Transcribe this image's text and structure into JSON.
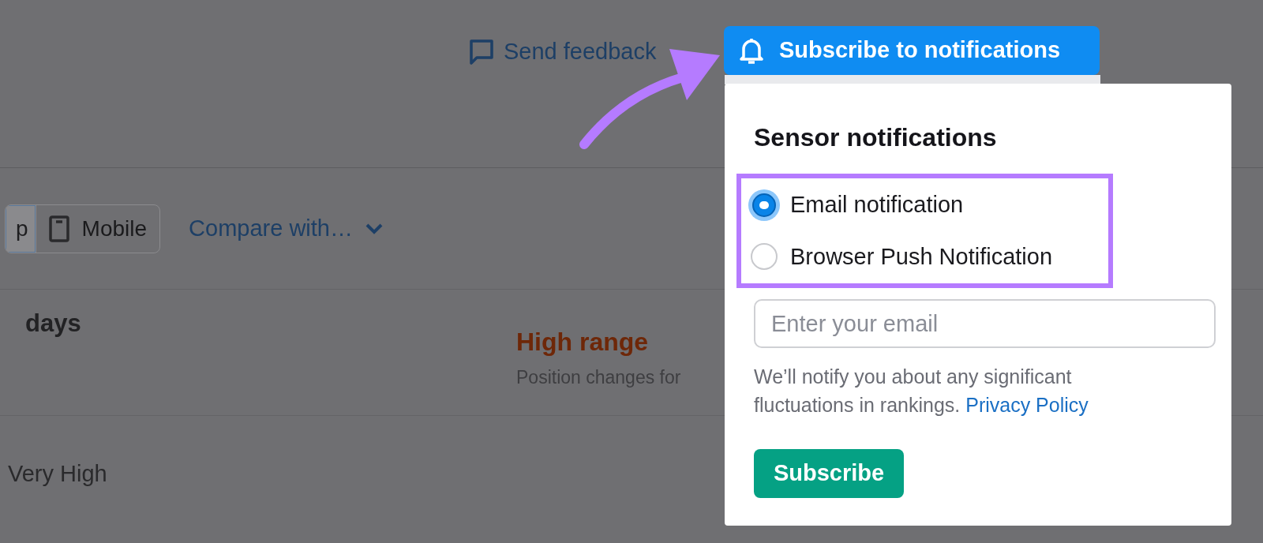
{
  "header": {
    "feedback_link": "Send feedback",
    "subscribe_button": "Subscribe to notifications"
  },
  "toolbar": {
    "device_tabs": [
      {
        "label": "p",
        "selected": true
      },
      {
        "label": "Mobile",
        "selected": false
      }
    ],
    "compare_dropdown": "Compare with…"
  },
  "summary": {
    "period": "days",
    "range_title": "High range",
    "range_description": "Position changes for"
  },
  "row": {
    "level_label": "Very High"
  },
  "popup": {
    "title": "Sensor notifications",
    "options": [
      {
        "label": "Email notification",
        "selected": true
      },
      {
        "label": "Browser Push Notification",
        "selected": false
      }
    ],
    "email_field": {
      "placeholder": "Enter your email"
    },
    "note": "We’ll notify you about any significant fluctuations in rankings.",
    "privacy_link": "Privacy Policy",
    "submit_button": "Subscribe"
  }
}
